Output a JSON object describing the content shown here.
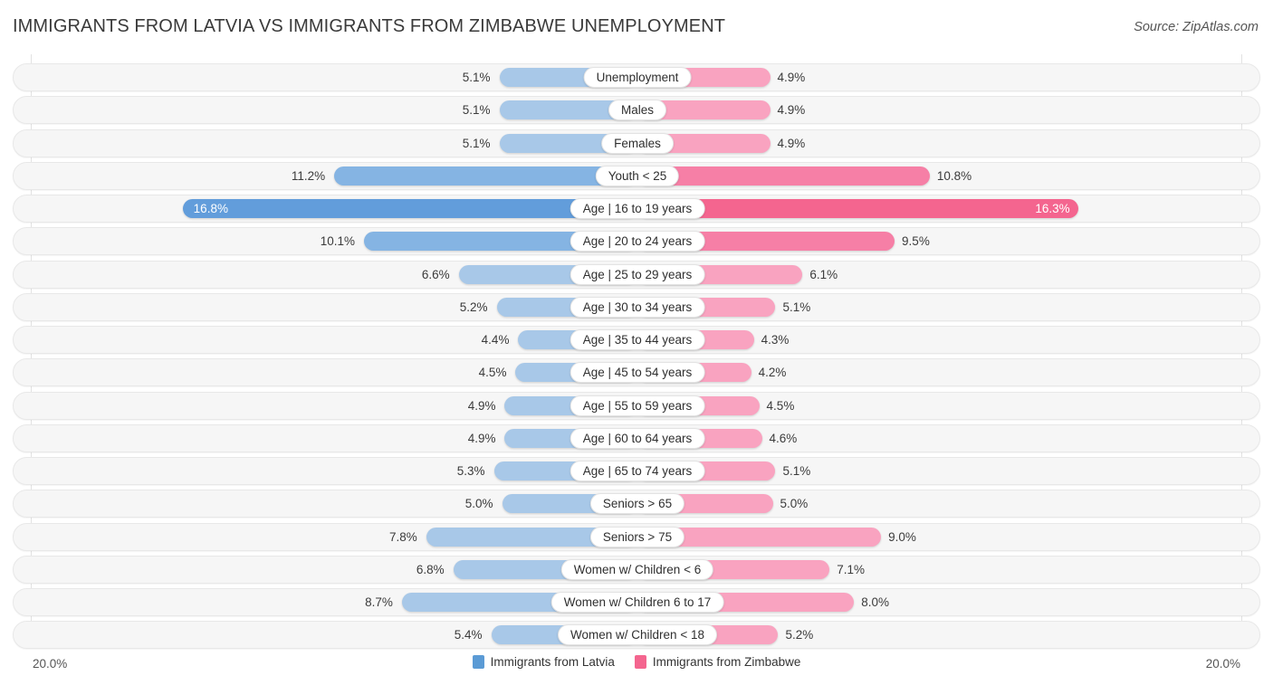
{
  "header": {
    "title": "IMMIGRANTS FROM LATVIA VS IMMIGRANTS FROM ZIMBABWE UNEMPLOYMENT",
    "source": "Source: ZipAtlas.com"
  },
  "axis": {
    "left_label": "20.0%",
    "right_label": "20.0%",
    "max": 20.0
  },
  "legend": {
    "items": [
      {
        "label": "Immigrants from Latvia",
        "color": "#5b9bd5"
      },
      {
        "label": "Immigrants from Zimbabwe",
        "color": "#f4658f"
      }
    ]
  },
  "colors": {
    "left_normal": "#a8c8e8",
    "left_mid": "#85b4e3",
    "left_max": "#629ddb",
    "right_normal": "#f9a3c0",
    "right_mid": "#f67fa6",
    "right_max": "#f4658f",
    "track": "#f6f6f6",
    "track_border": "#e8e8e8"
  },
  "chart_data": {
    "type": "bar",
    "title": "IMMIGRANTS FROM LATVIA VS IMMIGRANTS FROM ZIMBABWE UNEMPLOYMENT",
    "subtitle": "",
    "orientation": "horizontal-diverging",
    "xlabel": "",
    "ylabel": "",
    "xlim": [
      20.0,
      20.0
    ],
    "grid": false,
    "legend_position": "bottom-center",
    "categories": [
      "Unemployment",
      "Males",
      "Females",
      "Youth < 25",
      "Age | 16 to 19 years",
      "Age | 20 to 24 years",
      "Age | 25 to 29 years",
      "Age | 30 to 34 years",
      "Age | 35 to 44 years",
      "Age | 45 to 54 years",
      "Age | 55 to 59 years",
      "Age | 60 to 64 years",
      "Age | 65 to 74 years",
      "Seniors > 65",
      "Seniors > 75",
      "Women w/ Children < 6",
      "Women w/ Children 6 to 17",
      "Women w/ Children < 18"
    ],
    "series": [
      {
        "name": "Immigrants from Latvia",
        "values": [
          5.1,
          5.1,
          5.1,
          11.2,
          16.8,
          10.1,
          6.6,
          5.2,
          4.4,
          4.5,
          4.9,
          4.9,
          5.3,
          5.0,
          7.8,
          6.8,
          8.7,
          5.4
        ],
        "labels": [
          "5.1%",
          "5.1%",
          "5.1%",
          "11.2%",
          "16.8%",
          "10.1%",
          "6.6%",
          "5.2%",
          "4.4%",
          "4.5%",
          "4.9%",
          "4.9%",
          "5.3%",
          "5.0%",
          "7.8%",
          "6.8%",
          "8.7%",
          "5.4%"
        ]
      },
      {
        "name": "Immigrants from Zimbabwe",
        "values": [
          4.9,
          4.9,
          4.9,
          10.8,
          16.3,
          9.5,
          6.1,
          5.1,
          4.3,
          4.2,
          4.5,
          4.6,
          5.1,
          5.0,
          9.0,
          7.1,
          8.0,
          5.2
        ],
        "labels": [
          "4.9%",
          "4.9%",
          "4.9%",
          "10.8%",
          "16.3%",
          "9.5%",
          "6.1%",
          "5.1%",
          "4.3%",
          "4.2%",
          "4.5%",
          "4.6%",
          "5.1%",
          "5.0%",
          "9.0%",
          "7.1%",
          "8.0%",
          "5.2%"
        ]
      }
    ],
    "row_emphasis": [
      0,
      0,
      0,
      1,
      2,
      1,
      0,
      0,
      0,
      0,
      0,
      0,
      0,
      0,
      0,
      0,
      0,
      0
    ]
  }
}
